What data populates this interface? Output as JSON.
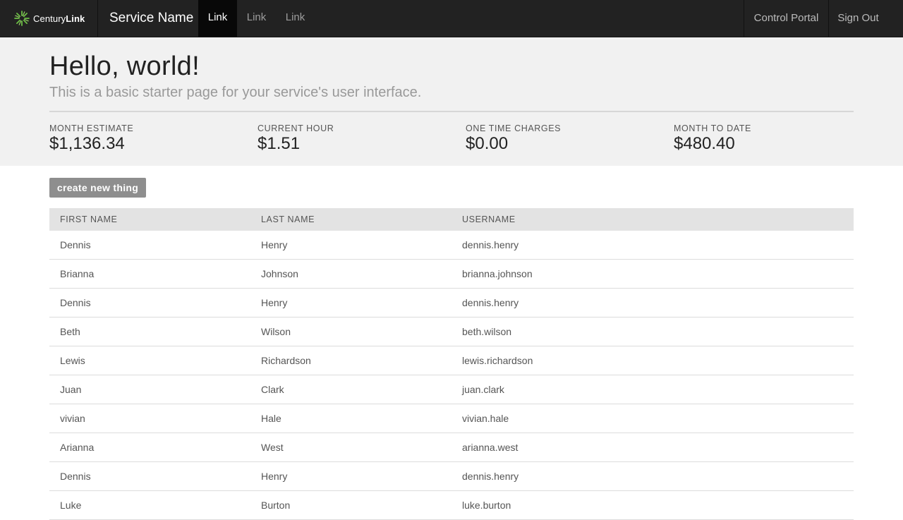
{
  "navbar": {
    "brand_prefix": "Century",
    "brand_suffix": "Link",
    "service_name": "Service Name",
    "links": [
      "Link",
      "Link",
      "Link"
    ],
    "right_links": [
      "Control Portal",
      "Sign Out"
    ]
  },
  "hero": {
    "title": "Hello, world!",
    "subtitle": "This is a basic starter page for your service's user interface."
  },
  "stats": [
    {
      "label": "MONTH ESTIMATE",
      "value": "$1,136.34"
    },
    {
      "label": "CURRENT HOUR",
      "value": "$1.51"
    },
    {
      "label": "ONE TIME CHARGES",
      "value": "$0.00"
    },
    {
      "label": "MONTH TO DATE",
      "value": "$480.40"
    }
  ],
  "create_button": "create new thing",
  "table": {
    "headers": [
      "FIRST NAME",
      "LAST NAME",
      "USERNAME"
    ],
    "rows": [
      [
        "Dennis",
        "Henry",
        "dennis.henry"
      ],
      [
        "Brianna",
        "Johnson",
        "brianna.johnson"
      ],
      [
        "Dennis",
        "Henry",
        "dennis.henry"
      ],
      [
        "Beth",
        "Wilson",
        "beth.wilson"
      ],
      [
        "Lewis",
        "Richardson",
        "lewis.richardson"
      ],
      [
        "Juan",
        "Clark",
        "juan.clark"
      ],
      [
        "vivian",
        "Hale",
        "vivian.hale"
      ],
      [
        "Arianna",
        "West",
        "arianna.west"
      ],
      [
        "Dennis",
        "Henry",
        "dennis.henry"
      ],
      [
        "Luke",
        "Burton",
        "luke.burton"
      ]
    ]
  },
  "colors": {
    "navbar_bg": "#222222",
    "hero_bg": "#f1f1f1",
    "button_bg": "#8e8e8e",
    "table_header_bg": "#e3e3e3",
    "logo_green": "#6cbe45"
  },
  "icons": {
    "logo": "centurylink-burst-icon"
  }
}
